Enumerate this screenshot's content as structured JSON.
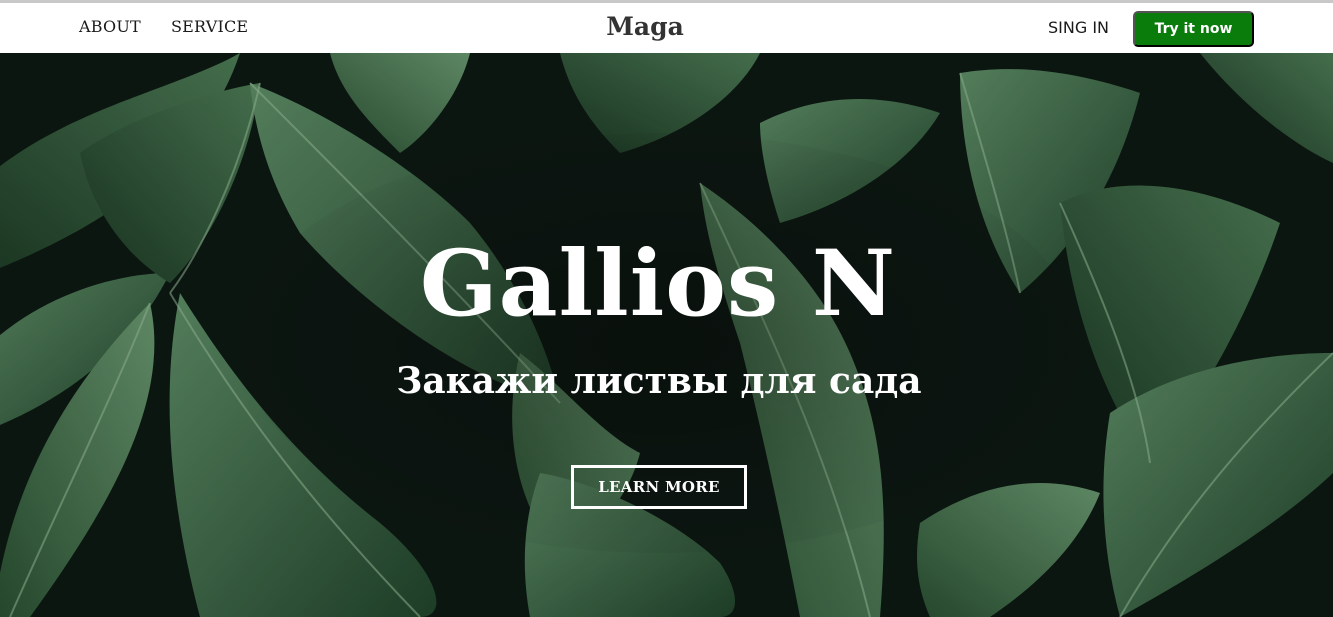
{
  "header": {
    "nav": [
      {
        "label": "ABOUT"
      },
      {
        "label": "SERVICE"
      }
    ],
    "brand": "Maga",
    "signin_label": "SING IN",
    "cta_label": "Try it now"
  },
  "hero": {
    "title": "Gallios N",
    "subtitle": "Закажи листвы для сада",
    "button_label": "LEARN MORE",
    "background": "green-leaves-photo"
  },
  "colors": {
    "accent": "#097c0c",
    "hero_dark": "#0e1a14",
    "leaf": "#3f6b4a",
    "text_light": "#ffffff",
    "text_dark": "#1a1a1a"
  }
}
